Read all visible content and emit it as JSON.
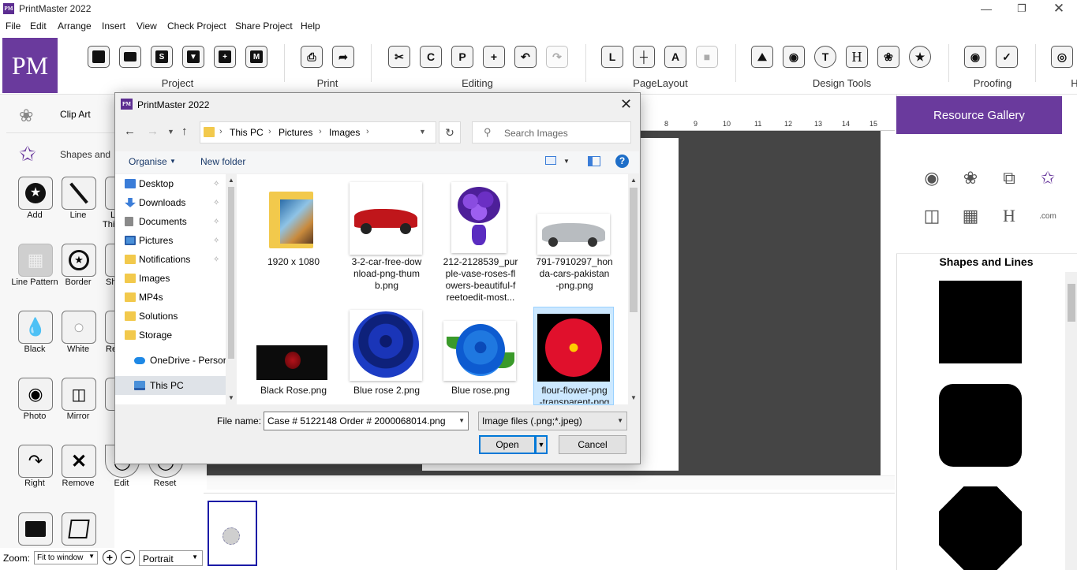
{
  "app": {
    "title": "PrintMaster 2022",
    "logo_text": "PM",
    "window_controls": [
      "minimize-icon",
      "restore-icon",
      "close-icon"
    ]
  },
  "menu": [
    "File",
    "Edit",
    "Arrange",
    "Insert",
    "View",
    "Check Project",
    "Share Project",
    "Help"
  ],
  "ribbon": {
    "logo": "PM",
    "groups": [
      "Project",
      "Print",
      "Editing",
      "PageLayout",
      "Design Tools",
      "Proofing",
      "H"
    ],
    "buttons": {
      "project": [
        "new-icon",
        "open-icon",
        "save-icon",
        "save-as-icon",
        "add-page-icon",
        "mail-icon"
      ],
      "print": [
        "printer-icon",
        "export-icon"
      ],
      "editing": [
        "cut-icon",
        "copy-icon",
        "paste-icon",
        "duplicate-icon",
        "undo-icon",
        "redo-icon"
      ],
      "pagelayout": [
        "layout-icon",
        "grid-icon",
        "text-fit-icon",
        "background-icon"
      ],
      "design": [
        "picture-icon",
        "camera-icon",
        "text-icon",
        "headline-icon",
        "clip-art-icon",
        "shapes-icon"
      ],
      "proofing": [
        "preview-icon",
        "spellcheck-icon"
      ],
      "help": [
        "lightbulb-icon"
      ]
    },
    "glyphs": {
      "T": "T",
      "H": "H",
      "L": "L",
      "C": "C",
      "P": "P",
      "M": "M",
      "S": "S",
      "A": "A"
    }
  },
  "left_panel": {
    "items": [
      {
        "label": "Clip Art"
      },
      {
        "label": "Shapes and"
      }
    ],
    "tools": [
      {
        "label": "Add",
        "icon": "star-circle-icon"
      },
      {
        "label": "Line",
        "icon": "line-icon"
      },
      {
        "label": "L",
        "icon": "line-thickness-icon",
        "label2": "Thi"
      },
      {
        "label": "Line Pattern",
        "icon": "pattern-icon"
      },
      {
        "label": "Border",
        "icon": "border-icon"
      },
      {
        "label": "Sh",
        "icon": "shadow-icon"
      },
      {
        "label": "Black",
        "icon": "black-drop-icon"
      },
      {
        "label": "White",
        "icon": "white-drop-icon"
      },
      {
        "label": "Re",
        "icon": "refill-icon"
      },
      {
        "label": "Photo",
        "icon": "camera-icon"
      },
      {
        "label": "Mirror",
        "icon": "mirror-icon"
      },
      {
        "label": "Right",
        "icon": "rotate-right-icon"
      },
      {
        "label": "Remove",
        "icon": "remove-icon"
      },
      {
        "label": "Edit",
        "icon": "edit-icon"
      },
      {
        "label": "Reset",
        "icon": "reset-icon"
      }
    ]
  },
  "zoom": {
    "label": "Zoom:",
    "value": "Fit to window",
    "orientation": "Portrait"
  },
  "ruler": [
    "8",
    "9",
    "10",
    "11",
    "12",
    "13",
    "14",
    "15"
  ],
  "gallery": {
    "title": "Resource Gallery",
    "section_title": "Shapes and Lines",
    "icons": [
      "camera-icon",
      "lotus-icon",
      "shapes-icon",
      "star-icon",
      "layout-icon",
      "panel-icon",
      "headline-icon",
      "cloud-com-icon"
    ],
    "cloud_text": ".com",
    "headline_glyph": "H"
  },
  "dialog": {
    "title": "PrintMaster 2022",
    "logo_text": "PM",
    "breadcrumb": [
      "This PC",
      "Pictures",
      "Images"
    ],
    "search_placeholder": "Search Images",
    "organise": "Organise",
    "new_folder": "New folder",
    "help_glyph": "?",
    "nav": [
      {
        "label": "Desktop",
        "pinned": true,
        "color": "#3b7dd8"
      },
      {
        "label": "Downloads",
        "pinned": true,
        "color": "#3b7dd8"
      },
      {
        "label": "Documents",
        "pinned": true,
        "color": "#8a8a8a"
      },
      {
        "label": "Pictures",
        "pinned": true,
        "color": "#4a90d9"
      },
      {
        "label": "Notifications",
        "pinned": true,
        "color": "#f2c94c"
      },
      {
        "label": "Images",
        "pinned": false,
        "color": "#f2c94c"
      },
      {
        "label": "MP4s",
        "pinned": false,
        "color": "#f2c94c"
      },
      {
        "label": "Solutions",
        "pinned": false,
        "color": "#f2c94c"
      },
      {
        "label": "Storage",
        "pinned": false,
        "color": "#f2c94c"
      },
      {
        "label": "OneDrive - Persor",
        "pinned": false,
        "color": "#1e88e5"
      },
      {
        "label": "This PC",
        "pinned": false,
        "color": "#4a90d9"
      }
    ],
    "files": [
      {
        "name": "1920 x 1080",
        "lines": [
          "1920 x 1080"
        ],
        "kind": "folder"
      },
      {
        "name": "3-2-car-free-download-png-thumb.png",
        "lines": [
          "3-2-car-free-dow",
          "nload-png-thum",
          "b.png"
        ],
        "kind": "red-car"
      },
      {
        "name": "212-2128539_purple-vase-roses-flowers-beautiful-freetoedit-most...",
        "lines": [
          "212-2128539_pur",
          "ple-vase-roses-fl",
          "owers-beautiful-f",
          "reetoedit-most..."
        ],
        "kind": "purple-flowers"
      },
      {
        "name": "791-7910297_honda-cars-pakistan-png.png",
        "lines": [
          "791-7910297_hon",
          "da-cars-pakistan",
          "-png.png"
        ],
        "kind": "silver-car"
      },
      {
        "name": "Black Rose.png",
        "lines": [
          "Black Rose.png"
        ],
        "kind": "black-rose"
      },
      {
        "name": "Blue rose 2.png",
        "lines": [
          "Blue rose 2.png"
        ],
        "kind": "blue-rose-2"
      },
      {
        "name": "Blue rose.png",
        "lines": [
          "Blue rose.png"
        ],
        "kind": "blue-rose"
      },
      {
        "name": "flour-flower-png-transparent-png",
        "lines": [
          "flour-flower-png",
          "-transparent-png"
        ],
        "kind": "red-flower"
      }
    ],
    "file_name_label": "File name:",
    "file_name_value": "Case # 5122148 Order # 2000068014.png",
    "file_type": "Image files (.png;*.jpeg)",
    "open_label": "Open",
    "cancel_label": "Cancel"
  }
}
